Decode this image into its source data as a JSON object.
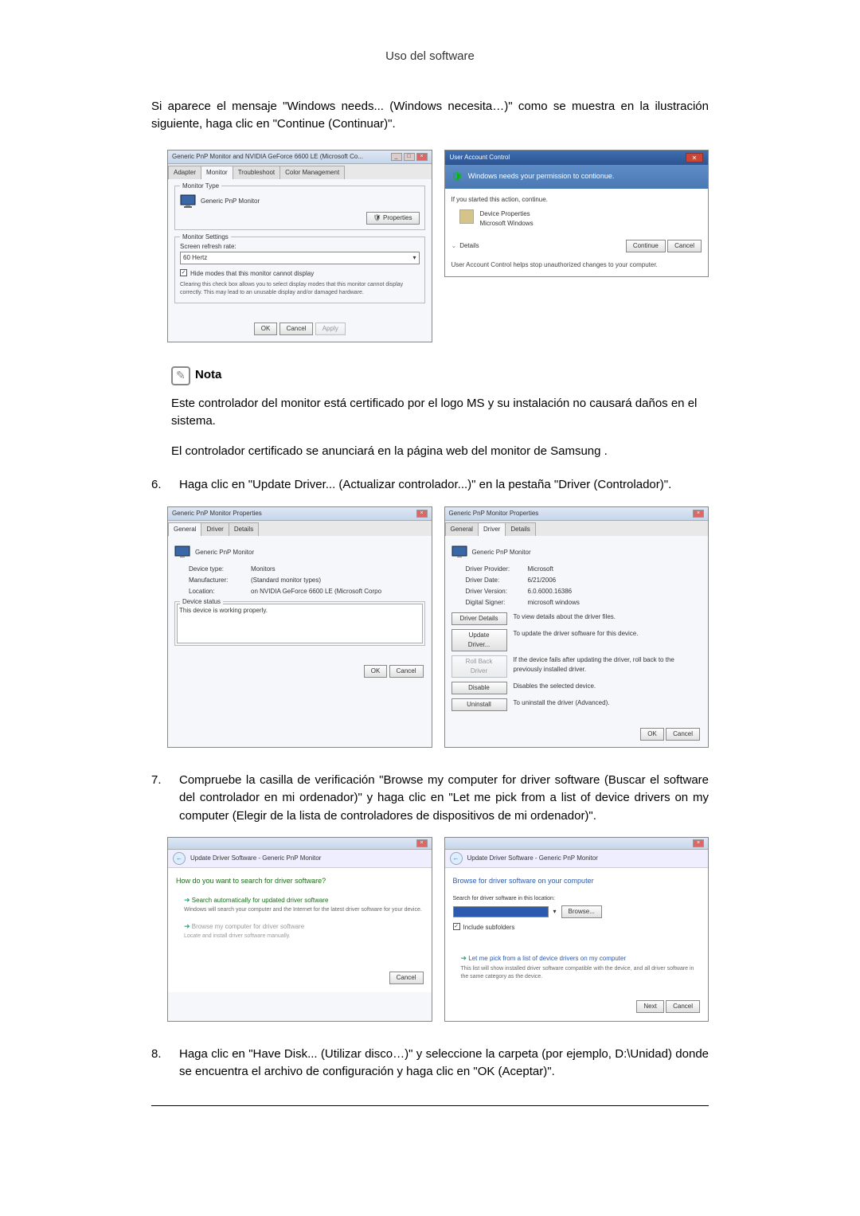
{
  "header": {
    "title": "Uso del software"
  },
  "intro": "Si aparece el mensaje \"Windows needs... (Windows necesita…)\" como se muestra en la ilustración siguiente, haga clic en \"Continue (Continuar)\".",
  "fig1": {
    "title": "Generic PnP Monitor and NVIDIA GeForce 6600 LE (Microsoft Co...",
    "tabs": {
      "adapter": "Adapter",
      "monitor": "Monitor",
      "troubleshoot": "Troubleshoot",
      "color": "Color Management"
    },
    "group_type": "Monitor Type",
    "monitor_name": "Generic PnP Monitor",
    "btn_properties": "Properties",
    "group_settings": "Monitor Settings",
    "refresh_label": "Screen refresh rate:",
    "refresh_value": "60 Hertz",
    "hide_checkbox": "Hide modes that this monitor cannot display",
    "hide_desc": "Clearing this check box allows you to select display modes that this monitor cannot display correctly. This may lead to an unusable display and/or damaged hardware.",
    "ok": "OK",
    "cancel": "Cancel",
    "apply": "Apply"
  },
  "fig2": {
    "title": "User Account Control",
    "banner": "Windows needs your permission to contionue.",
    "started": "If you started this action, continue.",
    "device_props": "Device Properties",
    "ms_windows": "Microsoft Windows",
    "details": "Details",
    "continue": "Continue",
    "cancel": "Cancel",
    "footer": "User Account Control helps stop unauthorized changes to your computer."
  },
  "note": {
    "title": "Nota",
    "p1": "Este controlador del monitor está certificado por el logo MS y su instalación no causará daños en el sistema.",
    "p2": "El controlador certificado se anunciará en la página web del monitor de Samsung ."
  },
  "step6": {
    "num": "6.",
    "text": "Haga clic en \"Update Driver... (Actualizar controlador...)\" en la pestaña \"Driver (Controlador)\"."
  },
  "fig3": {
    "title": "Generic PnP Monitor Properties",
    "tabs": {
      "general": "General",
      "driver": "Driver",
      "details": "Details"
    },
    "monitor": "Generic PnP Monitor",
    "device_type_l": "Device type:",
    "device_type_v": "Monitors",
    "manufacturer_l": "Manufacturer:",
    "manufacturer_v": "(Standard monitor types)",
    "location_l": "Location:",
    "location_v": "on NVIDIA GeForce 6600 LE (Microsoft Corpo",
    "status_group": "Device status",
    "status_text": "This device is working properly.",
    "ok": "OK",
    "cancel": "Cancel"
  },
  "fig4": {
    "title": "Generic PnP Monitor Properties",
    "tabs": {
      "general": "General",
      "driver": "Driver",
      "details": "Details"
    },
    "monitor": "Generic PnP Monitor",
    "provider_l": "Driver Provider:",
    "provider_v": "Microsoft",
    "date_l": "Driver Date:",
    "date_v": "6/21/2006",
    "version_l": "Driver Version:",
    "version_v": "6.0.6000.16386",
    "signer_l": "Digital Signer:",
    "signer_v": "microsoft windows",
    "b_details": "Driver Details",
    "d_details": "To view details about the driver files.",
    "b_update": "Update Driver...",
    "d_update": "To update the driver software for this device.",
    "b_rollback": "Roll Back Driver",
    "d_rollback": "If the device fails after updating the driver, roll back to the previously installed driver.",
    "b_disable": "Disable",
    "d_disable": "Disables the selected device.",
    "b_uninstall": "Uninstall",
    "d_uninstall": "To uninstall the driver (Advanced).",
    "ok": "OK",
    "cancel": "Cancel"
  },
  "step7": {
    "num": "7.",
    "text": "Compruebe la casilla de verificación \"Browse my computer for driver software (Buscar el software del controlador en mi ordenador)\" y haga clic en \"Let me pick from a list of device drivers on my computer (Elegir de la lista de controladores de dispositivos de mi ordenador)\"."
  },
  "fig5": {
    "nav": "Update Driver Software - Generic PnP Monitor",
    "heading": "How do you want to search for driver software?",
    "opt1_t": "Search automatically for updated driver software",
    "opt1_d": "Windows will search your computer and the Internet for the latest driver software for your device.",
    "opt2_t": "Browse my computer for driver software",
    "opt2_d": "Locate and install driver software manually.",
    "cancel": "Cancel"
  },
  "fig6": {
    "nav": "Update Driver Software - Generic PnP Monitor",
    "heading": "Browse for driver software on your computer",
    "search_l": "Search for driver software in this location:",
    "browse": "Browse...",
    "include_sub": "Include subfolders",
    "opt_t": "Let me pick from a list of device drivers on my computer",
    "opt_d": "This list will show installed driver software compatible with the device, and all driver software in the same category as the device.",
    "next": "Next",
    "cancel": "Cancel"
  },
  "step8": {
    "num": "8.",
    "text": "Haga clic en \"Have Disk... (Utilizar disco…)\" y seleccione la carpeta (por ejemplo, D:\\Unidad) donde se encuentra el archivo de configuración y haga clic en \"OK (Aceptar)\"."
  }
}
